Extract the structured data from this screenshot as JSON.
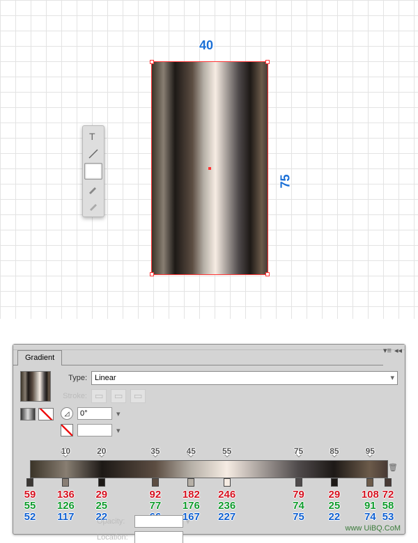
{
  "canvas": {
    "width_label": "40",
    "height_label": "75"
  },
  "tools": [
    "type",
    "line",
    "rectangle",
    "brush",
    "pencil"
  ],
  "panel": {
    "title": "Gradient",
    "type_label": "Type:",
    "type_value": "Linear",
    "stroke_label": "Stroke:",
    "angle_value": "0°",
    "opacity_label": "Opacity:",
    "location_label": "Location:"
  },
  "gradient": {
    "tick_positions": [
      10,
      20,
      35,
      45,
      55,
      75,
      85,
      95
    ],
    "stops": [
      {
        "pos": 0,
        "r": 59,
        "g": 55,
        "b": 52
      },
      {
        "pos": 10,
        "r": 136,
        "g": 126,
        "b": 117
      },
      {
        "pos": 20,
        "r": 29,
        "g": 25,
        "b": 22
      },
      {
        "pos": 35,
        "r": 92,
        "g": 77,
        "b": 66
      },
      {
        "pos": 45,
        "r": 182,
        "g": 176,
        "b": 167
      },
      {
        "pos": 55,
        "r": 246,
        "g": 236,
        "b": 227
      },
      {
        "pos": 75,
        "r": 79,
        "g": 74,
        "b": 75
      },
      {
        "pos": 85,
        "r": 29,
        "g": 25,
        "b": 22
      },
      {
        "pos": 95,
        "r": 108,
        "g": 91,
        "b": 74
      },
      {
        "pos": 100,
        "r": 72,
        "g": 58,
        "b": 53
      }
    ]
  },
  "watermark": "www UiBQ.CoM"
}
